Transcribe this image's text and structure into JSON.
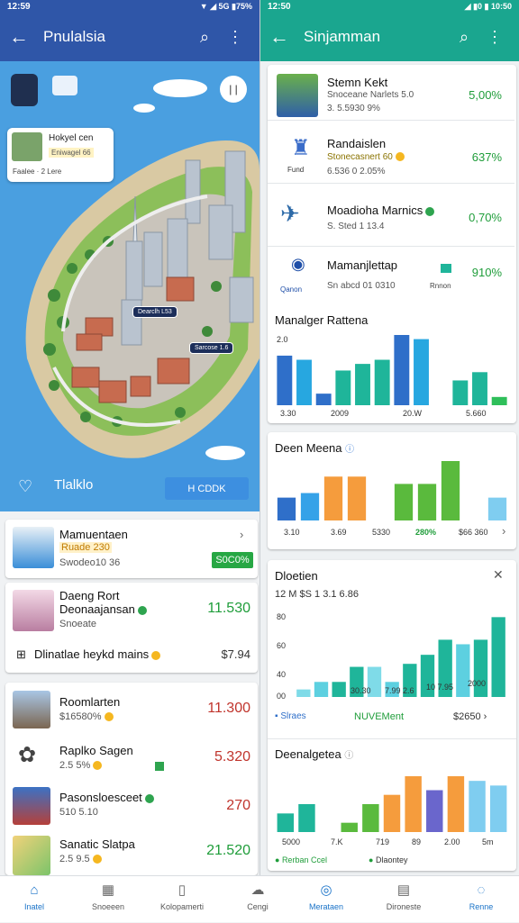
{
  "left": {
    "status": {
      "time": "12:59",
      "icons": "▼ ◢ 5G ▮75%"
    },
    "appbar": {
      "title": "Pnulalsia"
    },
    "map": {
      "place_card": {
        "name": "Hokyel cen",
        "tag": "Eniwagel 66",
        "foot": "Faalee  · 2 Lere"
      },
      "pin1": "Dearclh L53",
      "pin2": "Sarcose 1.6",
      "bottom_label": "Tlalklo",
      "button": "H CDDK"
    },
    "card1": {
      "title": "Mamuentaen",
      "tag": "Ruade 230",
      "sub": "Swodeo10 36",
      "button": "S0C0%"
    },
    "card2": {
      "title": "Daeng Rort",
      "title2": "Deonaajansan",
      "sub": "Snoeate",
      "value": "11.530",
      "row_label": "Dlinatlae heykd mains",
      "row_value": "$7.94"
    },
    "list": [
      {
        "title": "Roomlarten",
        "sub": "$16580%",
        "value": "11.300",
        "color": "red"
      },
      {
        "title": "Raplko Sagen",
        "sub": "2.5 5%",
        "value": "5.320",
        "color": "red"
      },
      {
        "title": "Pasonsloesceet",
        "sub": "510 5.10",
        "value": "270",
        "color": "red"
      },
      {
        "title": "Sanatic Slatpa",
        "sub": "2.5 9.5",
        "value": "21.520",
        "color": "green"
      }
    ]
  },
  "right": {
    "status": {
      "time": "12:50",
      "icons": "◢ ▮0 ▮ 10:50"
    },
    "appbar": {
      "title": "Sinjamman"
    },
    "rows": [
      {
        "title": "Stemn Kekt",
        "sub": "Snoceane Narlets 5.0",
        "sub2": "3. 5.5930 9%",
        "value": "5,00%"
      },
      {
        "title": "Randaislen",
        "sub": "Stonecasnert 60",
        "sub2": "6.536 0 2.05%",
        "value": "637%"
      },
      {
        "title": "Moadioha Marnics",
        "sub": "S. Sted 1 13.4",
        "sub2": "",
        "value": "0,70%"
      },
      {
        "title": "Mamanjlettap",
        "sub": "Sn abcd 01 0310",
        "sub2": "",
        "value": "910%",
        "tag": "Rnnon",
        "logo_label": "Qanon"
      }
    ],
    "row1_icon_label": "Fund",
    "chart1": {
      "title": "Manalger Rattena",
      "ytop": "2.0",
      "xlabels": [
        "3.30",
        "2009",
        "20.W",
        "5.660"
      ]
    },
    "chart2": {
      "title": "Deen Meena",
      "xlabels": [
        "3.10",
        "3.69",
        "5330",
        "280%",
        "$66 360"
      ]
    },
    "chart3": {
      "title": "Dloetien",
      "subtitle": "12 M  $S 1 3.1 6.86",
      "ylabels": [
        "80",
        "60",
        "40",
        "00"
      ],
      "xlabels": [
        "30.30",
        "7.99 2.6",
        "10 7.95",
        "2000"
      ],
      "legend_left": "Slraes",
      "legend_mid": "NUVEMent",
      "legend_right": "$2650"
    },
    "chart4": {
      "title": "Deenalgetea",
      "xlabels": [
        "5000",
        "7.K",
        "719",
        "89",
        "2.00",
        "5m"
      ],
      "legend_left": "Rerban Ccel",
      "legend_right": "Dlaontey"
    }
  },
  "chart_data": [
    {
      "type": "bar",
      "title": "Manalger Rattena",
      "categories": [
        "1",
        "2",
        "3",
        "4",
        "5",
        "6",
        "7",
        "8",
        "9",
        "10",
        "11",
        "12"
      ],
      "values": [
        60,
        55,
        14,
        42,
        50,
        55,
        85,
        80,
        0,
        30,
        40,
        10
      ],
      "colors": [
        "#2f6fc9",
        "#27a7e0",
        "#2f6fc9",
        "#1fb59a",
        "#1fb59a",
        "#1fb59a",
        "#2f6fc9",
        "#27a7e0",
        "#fff",
        "#1fb59a",
        "#1fb59a",
        "#2fbf5a"
      ]
    },
    {
      "type": "bar",
      "title": "Deen Meena",
      "categories": [
        "1",
        "2",
        "3",
        "4",
        "5",
        "6",
        "7",
        "8",
        "9",
        "10"
      ],
      "values": [
        25,
        30,
        48,
        48,
        0,
        40,
        40,
        65,
        0,
        25
      ],
      "colors": [
        "#2f6fc9",
        "#35a2e8",
        "#f59c3d",
        "#f59c3d",
        "#fff",
        "#5aba3d",
        "#5aba3d",
        "#5aba3d",
        "#fff",
        "#7fcdf0"
      ]
    },
    {
      "type": "bar",
      "title": "Dloetien",
      "categories": [
        "1",
        "2",
        "3",
        "4",
        "5",
        "6",
        "7",
        "8",
        "9",
        "10",
        "11",
        "12"
      ],
      "values": [
        5,
        10,
        10,
        20,
        20,
        10,
        22,
        28,
        38,
        35,
        38,
        53
      ],
      "colors": [
        "#7fdbe8",
        "#5dd0e0",
        "#1fb59a",
        "#1fb59a",
        "#7fdbe8",
        "#5dd0e0",
        "#1fb59a",
        "#1fb59a",
        "#1fb59a",
        "#5dd0e0",
        "#1fb59a",
        "#1fb59a"
      ]
    },
    {
      "type": "bar",
      "title": "Deenalgetea",
      "categories": [
        "1",
        "2",
        "3",
        "4",
        "5",
        "6",
        "7",
        "8",
        "9",
        "10",
        "11"
      ],
      "values": [
        20,
        30,
        0,
        10,
        30,
        40,
        60,
        45,
        60,
        55,
        50
      ],
      "colors": [
        "#1fb59a",
        "#1fb59a",
        "#fff",
        "#5aba3d",
        "#5aba3d",
        "#f59c3d",
        "#f59c3d",
        "#6a66cc",
        "#f59c3d",
        "#7fcdf0",
        "#7fcdf0"
      ]
    }
  ],
  "nav": [
    {
      "label": "Inatel",
      "icon": "home-icon",
      "glyph": "⌂",
      "active": true
    },
    {
      "label": "Snoeeen",
      "icon": "grid-icon",
      "glyph": "▦",
      "active": false
    },
    {
      "label": "Kolopamerti",
      "icon": "document-icon",
      "glyph": "▯",
      "active": false
    },
    {
      "label": "Cengi",
      "icon": "cloud-icon",
      "glyph": "☁",
      "active": false
    },
    {
      "label": "Merataen",
      "icon": "compass-icon",
      "glyph": "◎",
      "active": true
    },
    {
      "label": "Dironeste",
      "icon": "chart-icon",
      "glyph": "▤",
      "active": false
    },
    {
      "label": "Renne",
      "icon": "profile-icon",
      "glyph": "◌",
      "active": true
    }
  ]
}
